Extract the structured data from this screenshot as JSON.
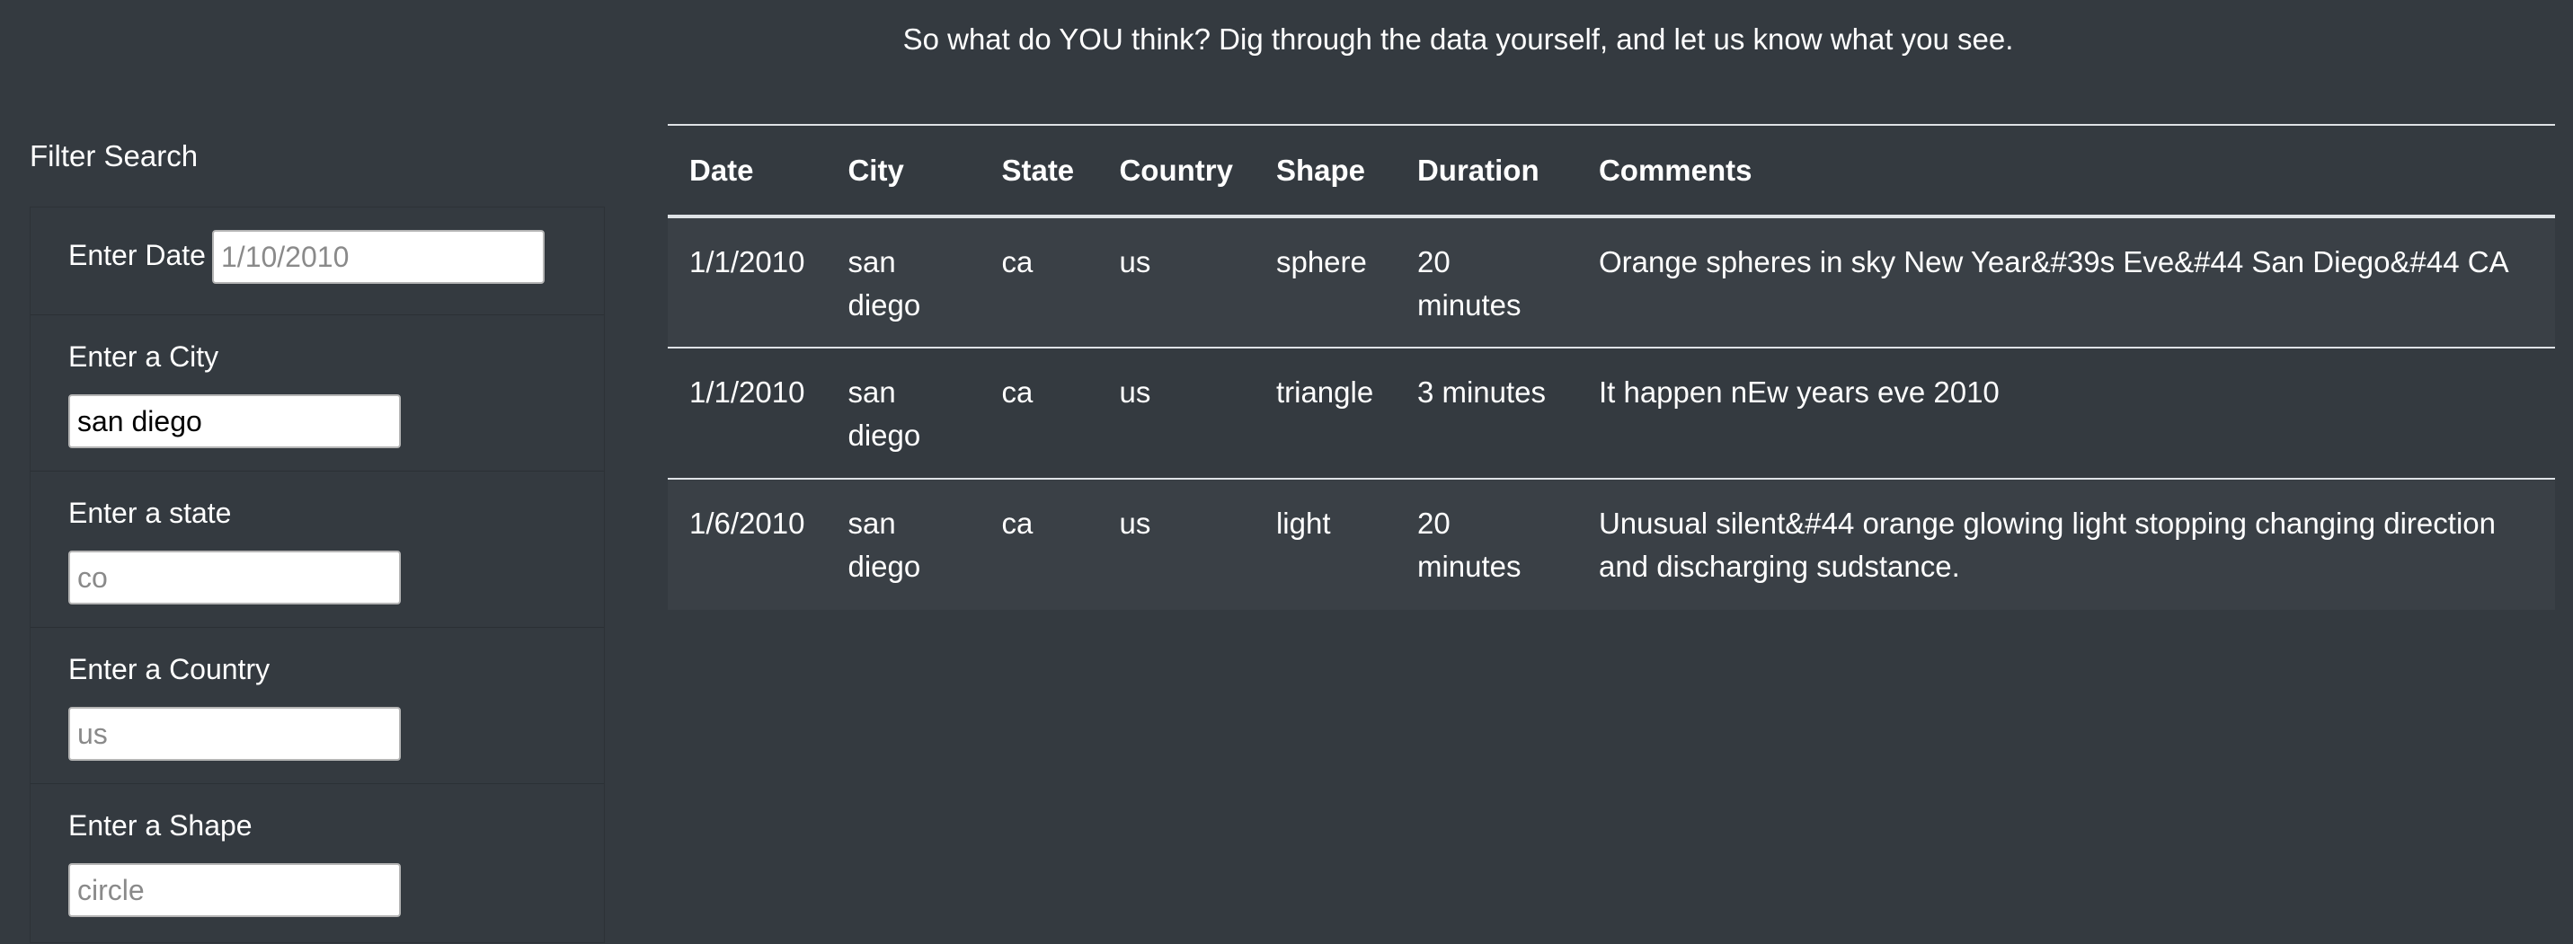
{
  "intro_text": "So what do YOU think? Dig through the data yourself, and let us know what you see.",
  "filter": {
    "title": "Filter Search",
    "fields": [
      {
        "label": "Enter Date",
        "value": "",
        "placeholder": "1/10/2010"
      },
      {
        "label": "Enter a City",
        "value": "san diego",
        "placeholder": ""
      },
      {
        "label": "Enter a state",
        "value": "",
        "placeholder": "co"
      },
      {
        "label": "Enter a Country",
        "value": "",
        "placeholder": "us"
      },
      {
        "label": "Enter a Shape",
        "value": "",
        "placeholder": "circle"
      }
    ]
  },
  "table": {
    "headers": [
      "Date",
      "City",
      "State",
      "Country",
      "Shape",
      "Duration",
      "Comments"
    ],
    "rows": [
      [
        "1/1/2010",
        "san diego",
        "ca",
        "us",
        "sphere",
        "20 minutes",
        "Orange spheres in sky New Year&#39s Eve&#44 San Diego&#44 CA"
      ],
      [
        "1/1/2010",
        "san diego",
        "ca",
        "us",
        "triangle",
        "3 minutes",
        "It happen nEw years eve 2010"
      ],
      [
        "1/6/2010",
        "san diego",
        "ca",
        "us",
        "light",
        "20 minutes",
        "Unusual silent&#44 orange glowing light stopping changing direction and discharging sudstance."
      ]
    ]
  }
}
